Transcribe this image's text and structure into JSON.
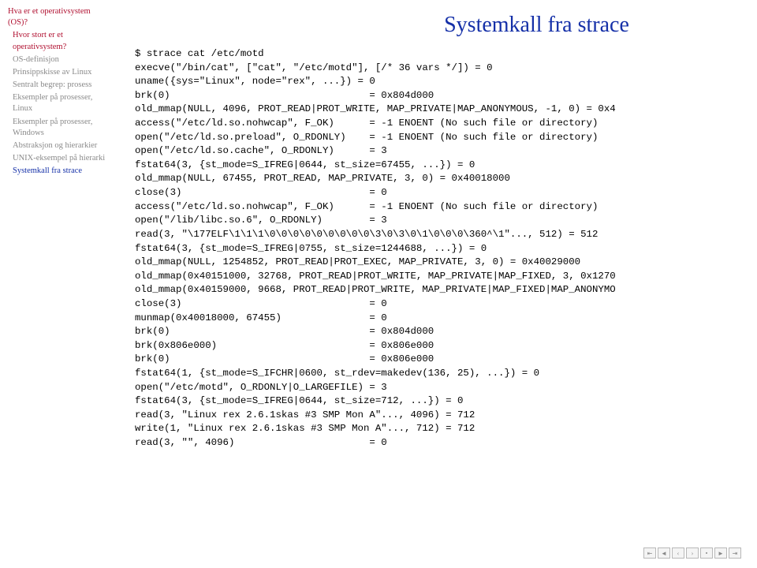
{
  "slide": {
    "title": "Systemkall fra strace"
  },
  "sidebar": {
    "items": [
      {
        "text": "Hva er et operativsystem (OS)?",
        "cls": "red"
      },
      {
        "text": "Hvor stort er et operativsystem?",
        "cls": "red indent"
      },
      {
        "text": "OS-definisjon",
        "cls": "gray indent"
      },
      {
        "text": "Prinsippskisse av Linux",
        "cls": "gray indent"
      },
      {
        "text": "Sentralt begrep: prosess",
        "cls": "gray indent"
      },
      {
        "text": "Eksempler på prosesser, Linux",
        "cls": "gray indent"
      },
      {
        "text": "Eksempler på prosesser, Windows",
        "cls": "gray indent"
      },
      {
        "text": "Abstraksjon og hierarkier",
        "cls": "gray indent"
      },
      {
        "text": "UNIX-eksempel på hierarki",
        "cls": "gray indent"
      },
      {
        "text": "Systemkall fra strace",
        "cls": "blue indent"
      }
    ]
  },
  "code": {
    "lines": [
      "$ strace cat /etc/motd",
      "execve(\"/bin/cat\", [\"cat\", \"/etc/motd\"], [/* 36 vars */]) = 0",
      "uname({sys=\"Linux\", node=\"rex\", ...}) = 0",
      "brk(0)                                  = 0x804d000",
      "old_mmap(NULL, 4096, PROT_READ|PROT_WRITE, MAP_PRIVATE|MAP_ANONYMOUS, -1, 0) = 0x4",
      "access(\"/etc/ld.so.nohwcap\", F_OK)      = -1 ENOENT (No such file or directory)",
      "open(\"/etc/ld.so.preload\", O_RDONLY)    = -1 ENOENT (No such file or directory)",
      "open(\"/etc/ld.so.cache\", O_RDONLY)      = 3",
      "fstat64(3, {st_mode=S_IFREG|0644, st_size=67455, ...}) = 0",
      "old_mmap(NULL, 67455, PROT_READ, MAP_PRIVATE, 3, 0) = 0x40018000",
      "close(3)                                = 0",
      "access(\"/etc/ld.so.nohwcap\", F_OK)      = -1 ENOENT (No such file or directory)",
      "open(\"/lib/libc.so.6\", O_RDONLY)        = 3",
      "read(3, \"\\177ELF\\1\\1\\1\\0\\0\\0\\0\\0\\0\\0\\0\\0\\3\\0\\3\\0\\1\\0\\0\\0\\360^\\1\"..., 512) = 512",
      "fstat64(3, {st_mode=S_IFREG|0755, st_size=1244688, ...}) = 0",
      "old_mmap(NULL, 1254852, PROT_READ|PROT_EXEC, MAP_PRIVATE, 3, 0) = 0x40029000",
      "old_mmap(0x40151000, 32768, PROT_READ|PROT_WRITE, MAP_PRIVATE|MAP_FIXED, 3, 0x1270",
      "old_mmap(0x40159000, 9668, PROT_READ|PROT_WRITE, MAP_PRIVATE|MAP_FIXED|MAP_ANONYMO",
      "close(3)                                = 0",
      "munmap(0x40018000, 67455)               = 0",
      "brk(0)                                  = 0x804d000",
      "brk(0x806e000)                          = 0x806e000",
      "brk(0)                                  = 0x806e000",
      "fstat64(1, {st_mode=S_IFCHR|0600, st_rdev=makedev(136, 25), ...}) = 0",
      "open(\"/etc/motd\", O_RDONLY|O_LARGEFILE) = 3",
      "fstat64(3, {st_mode=S_IFREG|0644, st_size=712, ...}) = 0",
      "read(3, \"Linux rex 2.6.1skas #3 SMP Mon A\"..., 4096) = 712",
      "write(1, \"Linux rex 2.6.1skas #3 SMP Mon A\"..., 712) = 712",
      "read(3, \"\", 4096)                       = 0"
    ]
  },
  "footer": {
    "icons": [
      "first",
      "prev",
      "back",
      "next",
      "search",
      "fwd",
      "last"
    ]
  }
}
